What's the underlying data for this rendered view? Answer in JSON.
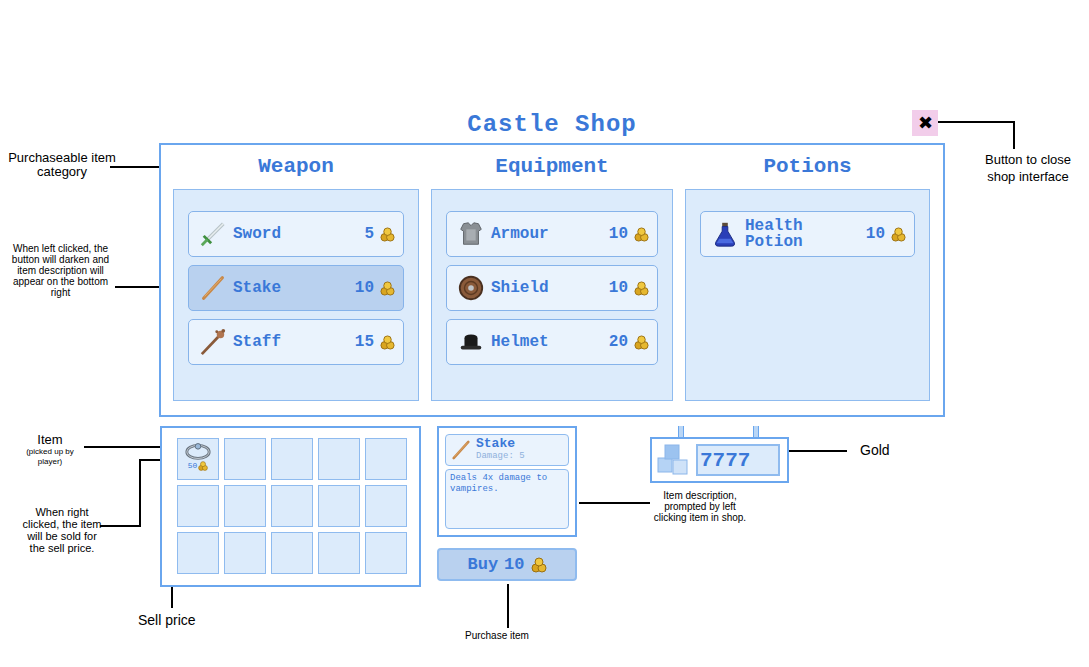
{
  "title": "Castle Shop",
  "close_button": {
    "label": "✖"
  },
  "categories": [
    {
      "title": "Weapon",
      "items": [
        {
          "name": "Sword",
          "price": "5",
          "selected": false,
          "kind": "sword"
        },
        {
          "name": "Stake",
          "price": "10",
          "selected": true,
          "kind": "stake"
        },
        {
          "name": "Staff",
          "price": "15",
          "selected": false,
          "kind": "staff"
        }
      ]
    },
    {
      "title": "Equipment",
      "items": [
        {
          "name": "Armour",
          "price": "10",
          "selected": false,
          "kind": "armour"
        },
        {
          "name": "Shield",
          "price": "10",
          "selected": false,
          "kind": "shield"
        },
        {
          "name": "Helmet",
          "price": "20",
          "selected": false,
          "kind": "helmet"
        }
      ]
    },
    {
      "title": "Potions",
      "items": [
        {
          "name": "Health Potion",
          "price": "10",
          "selected": false,
          "kind": "potion"
        }
      ]
    }
  ],
  "inventory": {
    "slots": [
      {
        "filled": true,
        "sell_price": "50"
      },
      {
        "filled": false
      },
      {
        "filled": false
      },
      {
        "filled": false
      },
      {
        "filled": false
      },
      {
        "filled": false
      },
      {
        "filled": false
      },
      {
        "filled": false
      },
      {
        "filled": false
      },
      {
        "filled": false
      },
      {
        "filled": false
      },
      {
        "filled": false
      },
      {
        "filled": false
      },
      {
        "filled": false
      },
      {
        "filled": false
      }
    ]
  },
  "description": {
    "name": "Stake",
    "stat": "Damage: 5",
    "text": "Deals 4x damage to vampires.",
    "kind": "stake"
  },
  "buy_button": {
    "label": "Buy",
    "price": "10"
  },
  "gold": {
    "amount": "7777"
  },
  "annotations": [
    {
      "text": "Purchaseable item category"
    },
    {
      "text": "When left clicked, the button will darken and item description will appear on the bottom right"
    },
    {
      "text": "Item",
      "note": "(picked up by player)"
    },
    {
      "text": "When right clicked, the item will be sold for the sell price."
    },
    {
      "text": "Sell price"
    },
    {
      "text": "Purchase item"
    },
    {
      "text": "Item description, prompted by left clicking item in shop."
    },
    {
      "text": "Gold"
    },
    {
      "text": "Button to close shop interface"
    }
  ]
}
